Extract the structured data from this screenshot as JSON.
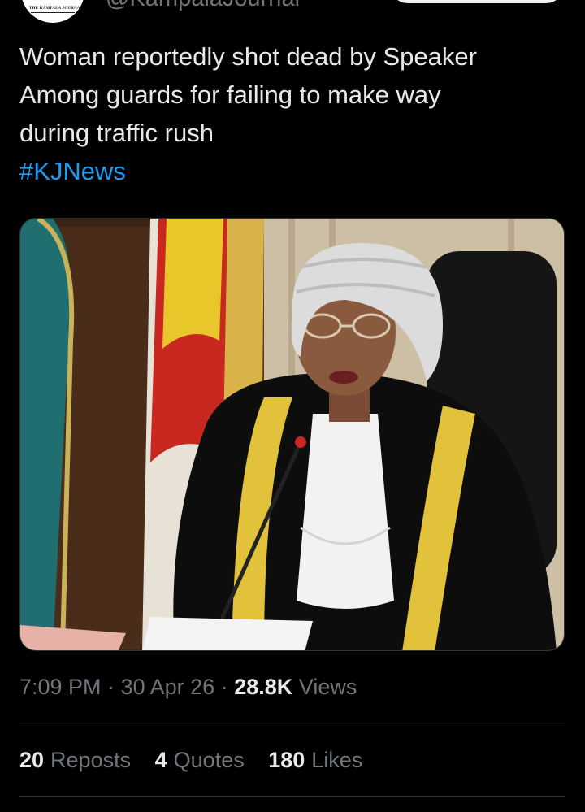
{
  "author": {
    "handle": "@KampalaJournal",
    "avatar_text": "THE KAMPALA JOURNAL"
  },
  "tweet": {
    "text_lines": [
      "Woman reportedly shot dead by Speaker",
      "Among guards for failing to make way",
      "during traffic rush"
    ],
    "hashtag": "#KJNews",
    "time": "7:09 PM",
    "separator": "·",
    "date": "30 Apr 26",
    "views_count": "28.8K",
    "views_label": "Views"
  },
  "stats": {
    "reposts_count": "20",
    "reposts_label": "Reposts",
    "quotes_count": "4",
    "quotes_label": "Quotes",
    "likes_count": "180",
    "likes_label": "Likes"
  },
  "colors": {
    "background": "#000000",
    "text": "#e7e9ea",
    "muted": "#71767b",
    "link": "#1d9bf0",
    "divider": "#2f3336"
  }
}
